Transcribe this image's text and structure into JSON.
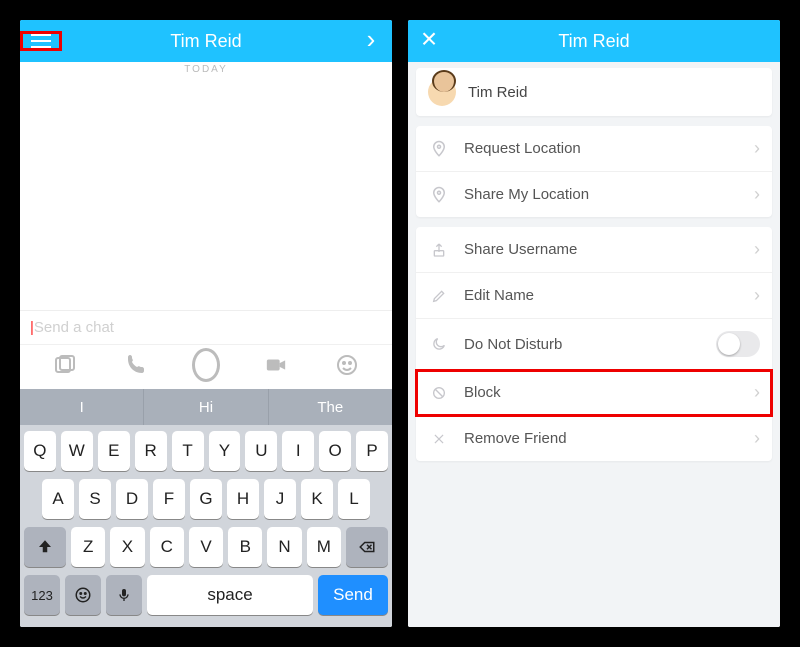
{
  "left": {
    "header": {
      "title": "Tim Reid"
    },
    "today_label": "TODAY",
    "chat_placeholder": "Send a chat",
    "suggestions": [
      "I",
      "Hi",
      "The"
    ],
    "keyboard": {
      "row1": [
        "Q",
        "W",
        "E",
        "R",
        "T",
        "Y",
        "U",
        "I",
        "O",
        "P"
      ],
      "row2": [
        "A",
        "S",
        "D",
        "F",
        "G",
        "H",
        "J",
        "K",
        "L"
      ],
      "row3": [
        "Z",
        "X",
        "C",
        "V",
        "B",
        "N",
        "M"
      ],
      "numkey": "123",
      "space": "space",
      "send": "Send"
    }
  },
  "right": {
    "header": {
      "title": "Tim Reid"
    },
    "profile_name": "Tim Reid",
    "rows": {
      "request_location": "Request Location",
      "share_my_location": "Share My Location",
      "share_username": "Share Username",
      "edit_name": "Edit Name",
      "do_not_disturb": "Do Not Disturb",
      "block": "Block",
      "remove_friend": "Remove Friend"
    }
  }
}
